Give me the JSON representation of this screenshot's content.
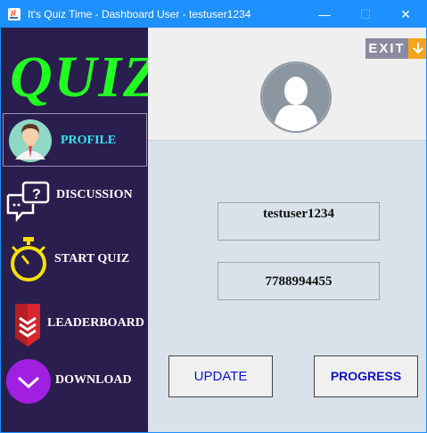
{
  "window": {
    "title": "It's Quiz Time - Dashboard User - testuser1234",
    "controls": {
      "minimize": "—",
      "maximize": "☐",
      "close": "✕"
    }
  },
  "sidebar": {
    "logo": "QUIZ",
    "items": [
      {
        "label": "PROFILE",
        "icon": "user-avatar-icon",
        "active": true
      },
      {
        "label": "DISCUSSION",
        "icon": "chat-bubbles-icon",
        "active": false
      },
      {
        "label": "START QUIZ",
        "icon": "stopwatch-icon",
        "active": false
      },
      {
        "label": "LEADERBOARD",
        "icon": "rank-badge-icon",
        "active": false
      },
      {
        "label": "DOWNLOAD",
        "icon": "download-circle-icon",
        "active": false
      }
    ]
  },
  "main": {
    "exit_label": "EXIT",
    "profile_avatar_icon": "profile-avatar-icon",
    "username": "testuser1234",
    "phone": "7788994455",
    "update_label": "UPDATE",
    "progress_label": "PROGRESS"
  },
  "colors": {
    "titlebar": "#1e90ff",
    "sidebar": "#2a1e4e",
    "logo": "#22ff22",
    "active_label": "#33e7f5",
    "button_text": "#1212c8",
    "exit_accent": "#f4a51c"
  }
}
